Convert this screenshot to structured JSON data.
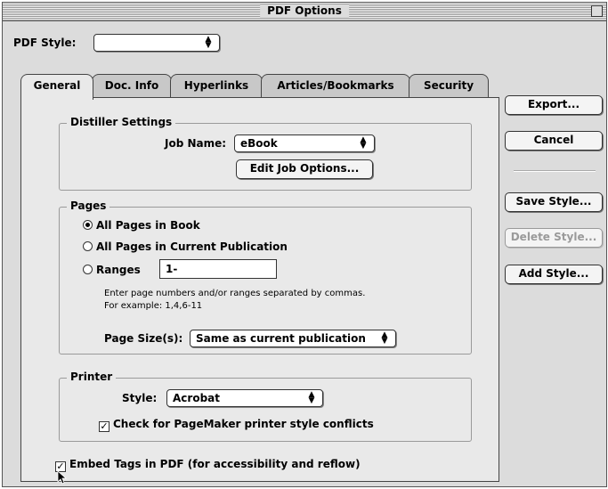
{
  "window": {
    "title": "PDF Options"
  },
  "pdf_style": {
    "label": "PDF Style:",
    "value": ""
  },
  "tabs": [
    {
      "label": "General",
      "active": true
    },
    {
      "label": "Doc. Info"
    },
    {
      "label": "Hyperlinks"
    },
    {
      "label": "Articles/Bookmarks"
    },
    {
      "label": "Security"
    }
  ],
  "distiller": {
    "title": "Distiller Settings",
    "job_name_label": "Job Name:",
    "job_name_value": "eBook",
    "edit_button": "Edit Job Options..."
  },
  "pages": {
    "title": "Pages",
    "all_in_book": "All Pages in Book",
    "all_in_pub": "All Pages in Current Publication",
    "ranges_label": "Ranges",
    "ranges_value": "1-",
    "hint_line1": "Enter page numbers and/or ranges separated by commas.",
    "hint_line2": "For example: 1,4,6-11",
    "page_size_label": "Page Size(s):",
    "page_size_value": "Same as current publication"
  },
  "printer": {
    "title": "Printer",
    "style_label": "Style:",
    "style_value": "Acrobat",
    "check_conflicts": "Check for PageMaker printer style conflicts"
  },
  "embed_tags": "Embed Tags in PDF (for accessibility and reflow)",
  "buttons": {
    "export": "Export...",
    "cancel": "Cancel",
    "save_style": "Save Style...",
    "delete_style": "Delete Style...",
    "add_style": "Add Style..."
  }
}
